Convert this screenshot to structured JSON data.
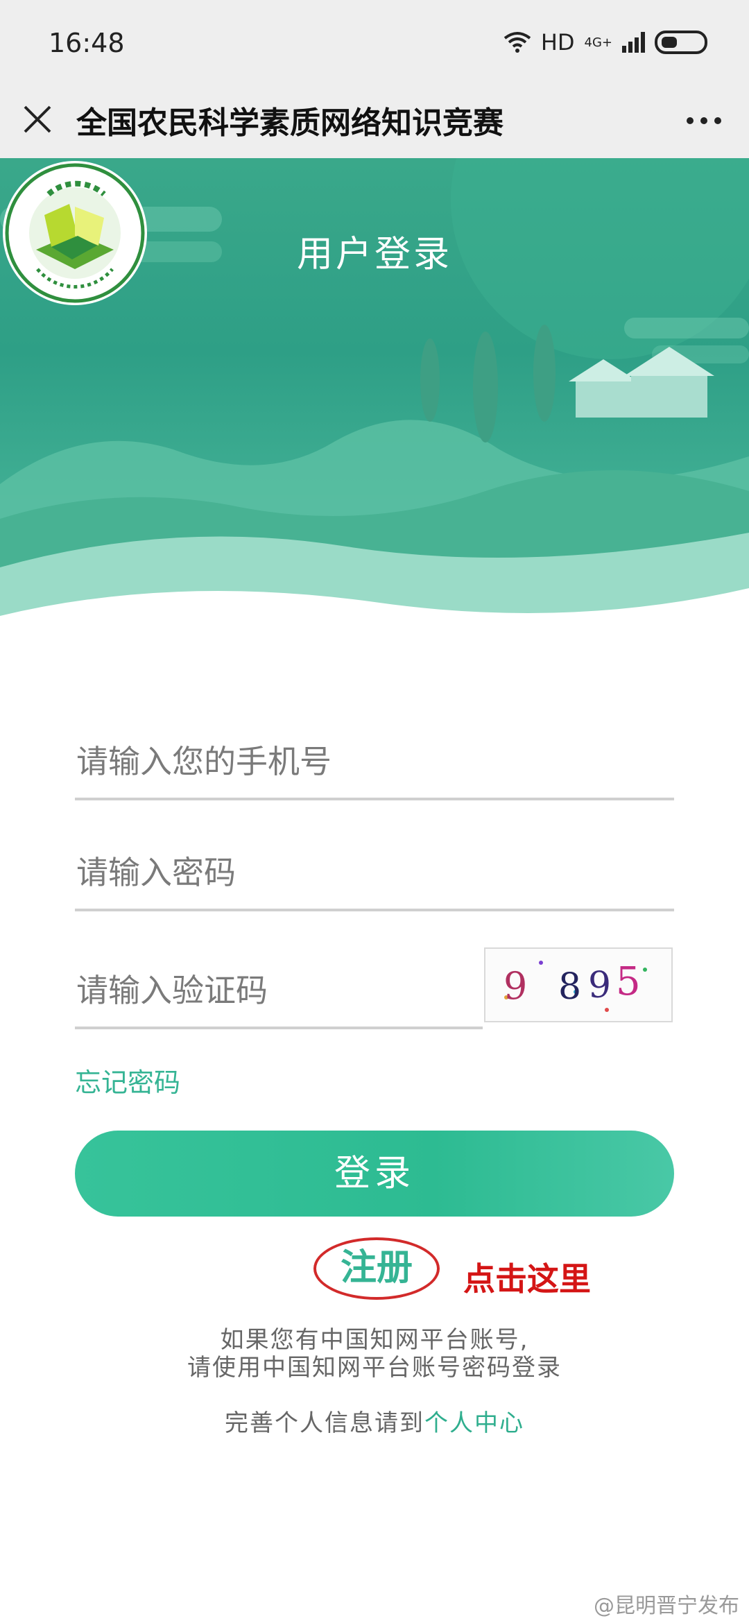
{
  "status_bar": {
    "time": "16:48",
    "hd_label": "HD",
    "network_label": "4G+",
    "icons": [
      "wifi-icon",
      "signal-icon",
      "battery-icon"
    ]
  },
  "nav": {
    "title": "全国农民科学素质网络知识竞赛",
    "icons": [
      "close-icon",
      "more-icon"
    ]
  },
  "hero": {
    "title": "用户登录",
    "logo_text_top": "全国农民科学素质网络竞赛",
    "logo_text_bottom": "Quanguonongminkexuesuzhiwangluojingsai"
  },
  "form": {
    "phone_placeholder": "请输入您的手机号",
    "password_placeholder": "请输入密码",
    "code_placeholder": "请输入验证码",
    "captcha_text": "9895",
    "forgot_label": "忘记密码",
    "login_label": "登录",
    "register_label": "注册",
    "annotation": "点击这里"
  },
  "info": {
    "line1": "如果您有中国知网平台账号,",
    "line2": "请使用中国知网平台账号密码登录",
    "line3_prefix": "完善个人信息请到",
    "line3_link": "个人中心"
  },
  "watermark": "@昆明晋宁发布",
  "colors": {
    "accent": "#35b494",
    "hero_green": "#2e9f86",
    "annotation_red": "#d41515"
  }
}
